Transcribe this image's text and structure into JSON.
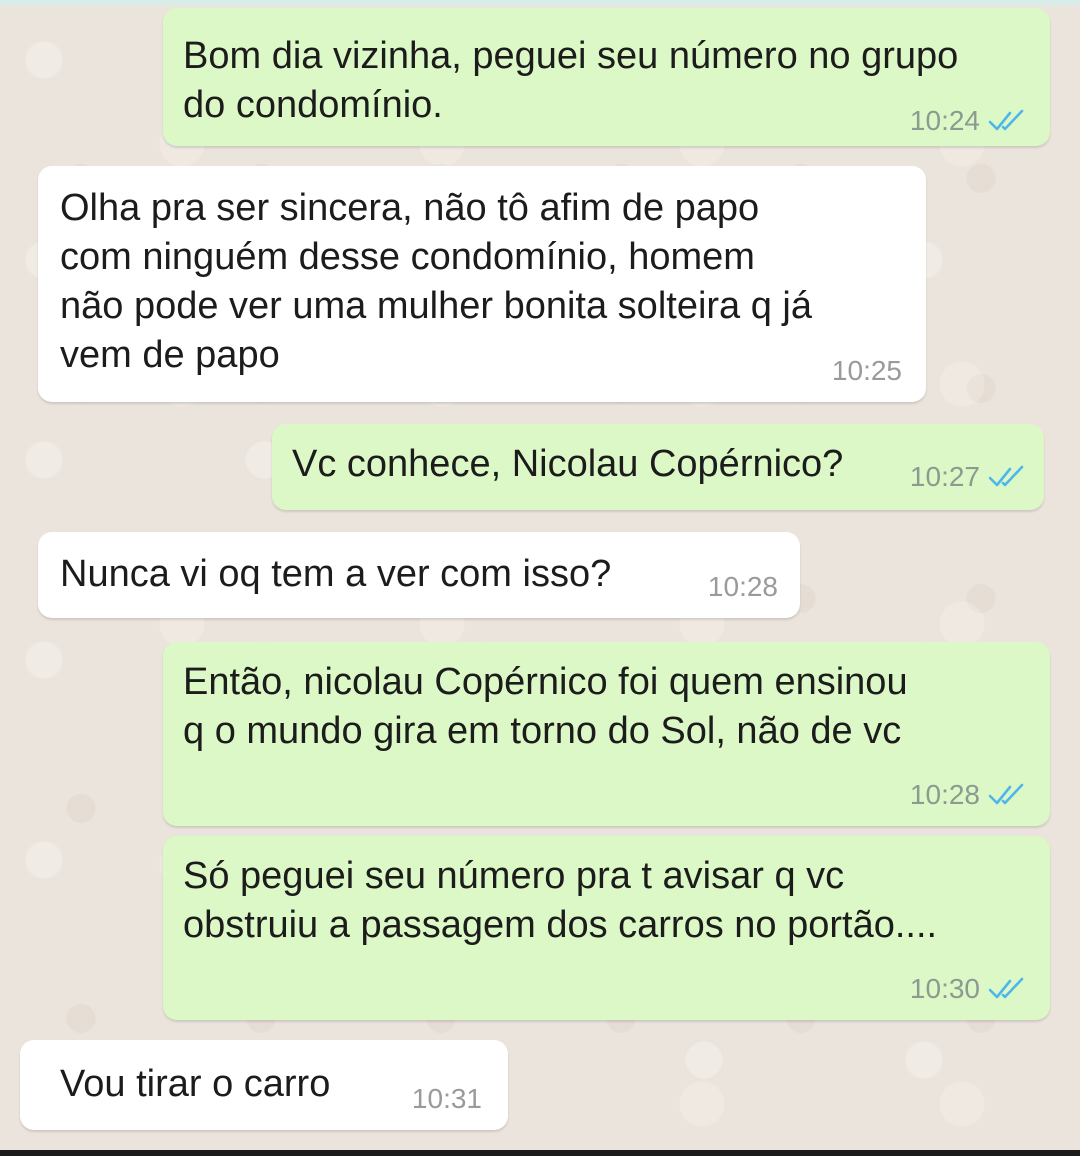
{
  "conversation": {
    "messages": [
      {
        "direction": "out",
        "text": "Bom dia vizinha, peguei seu número no grupo\ndo condomínio.",
        "time": "10:24",
        "status_icon": "double-check-read-icon",
        "check_color": "#4fb6ec"
      },
      {
        "direction": "in",
        "text": "Olha pra ser sincera, não tô afim de papo\ncom ninguém desse condomínio, homem\nnão pode ver uma mulher bonita solteira q já\nvem de papo",
        "time": "10:25"
      },
      {
        "direction": "out",
        "text": "Vc conhece, Nicolau Copérnico?",
        "time": "10:27",
        "status_icon": "double-check-read-icon",
        "check_color": "#4fb6ec"
      },
      {
        "direction": "in",
        "text": "Nunca vi oq tem a ver com isso?",
        "time": "10:28"
      },
      {
        "direction": "out",
        "text": "Então, nicolau Copérnico foi quem ensinou\nq o mundo gira em torno do Sol, não de vc",
        "time": "10:28",
        "status_icon": "double-check-read-icon",
        "check_color": "#4fb6ec"
      },
      {
        "direction": "out",
        "text": "Só peguei seu número pra t avisar q vc\nobstruiu a passagem dos carros no portão....",
        "time": "10:30",
        "status_icon": "double-check-read-icon",
        "check_color": "#4fb6ec"
      },
      {
        "direction": "in",
        "text": "Vou tirar o carro",
        "time": "10:31"
      }
    ]
  },
  "colors": {
    "outgoing_bubble": "#dcf8c6",
    "incoming_bubble": "#ffffff",
    "chat_background": "#ebe4dc",
    "read_receipt": "#4fb6ec"
  }
}
